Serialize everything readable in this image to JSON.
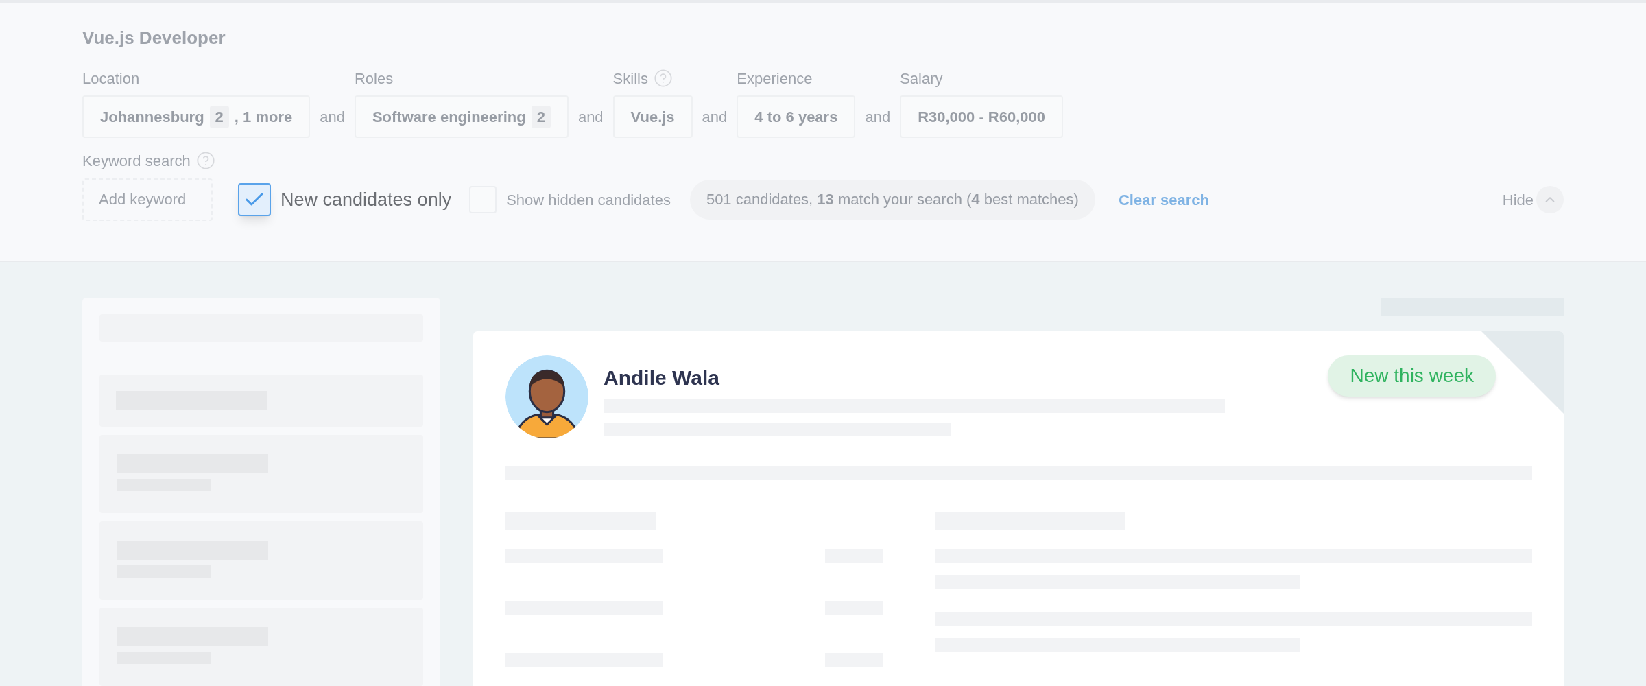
{
  "search": {
    "title": "Vue.js Developer",
    "filters": [
      {
        "label": "Location",
        "help": false,
        "value": "Johannesburg",
        "count": "2",
        "extra": ", 1 more"
      },
      {
        "joiner": "and",
        "label": "Roles",
        "help": false,
        "value": "Software engineering",
        "count": "2"
      },
      {
        "joiner": "and",
        "label": "Skills",
        "help": true,
        "value": "Vue.js"
      },
      {
        "joiner": "and",
        "label": "Experience",
        "help": false,
        "value": "4 to 6 years"
      },
      {
        "joiner": "and",
        "label": "Salary",
        "help": false,
        "value": "R30,000 -  R60,000"
      }
    ],
    "keyword": {
      "label": "Keyword search",
      "help": true,
      "placeholder": "Add keyword"
    },
    "checkboxes": [
      {
        "label": "New candidates only",
        "checked": true,
        "highlighted": true
      },
      {
        "label": "Show hidden candidates",
        "checked": false,
        "highlighted": false
      }
    ],
    "summary": "501 candidates, **13** match your search (**4** best matches)",
    "clear_link": "Clear search",
    "hide_button": "Hide"
  },
  "candidate": {
    "name": "Andile Wala",
    "badge": "New this week"
  }
}
